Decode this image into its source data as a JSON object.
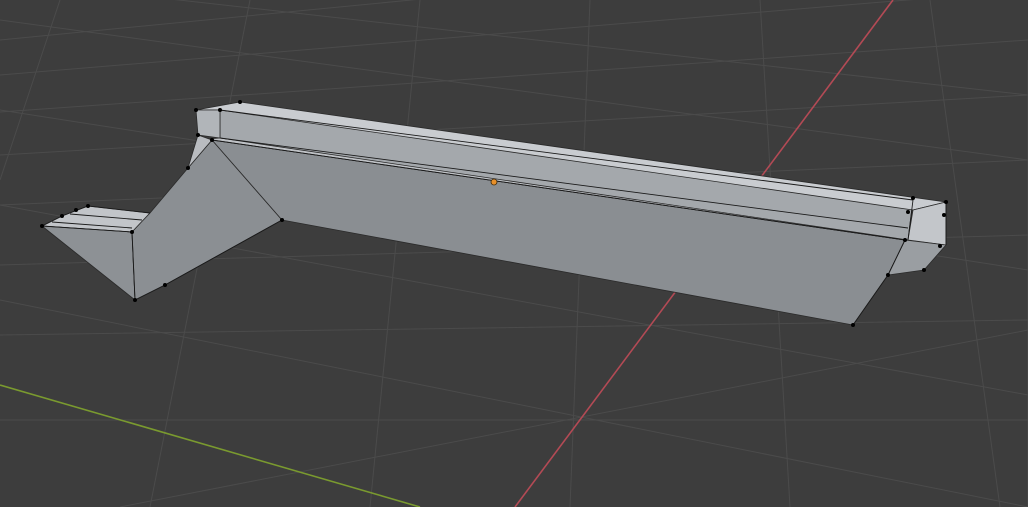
{
  "viewport": {
    "mode": "edit-mode",
    "background_color": "#3d3d3d",
    "grid_color": "#4a4a4a",
    "x_axis_color": "#b34a55",
    "y_axis_color": "#7a9a2f",
    "origin_marker_color": "#e8902a",
    "vertex_color": "#000000",
    "face_colors": {
      "light": "#c4c7cb",
      "mid": "#a7abaf",
      "dark": "#8b8f93"
    }
  }
}
